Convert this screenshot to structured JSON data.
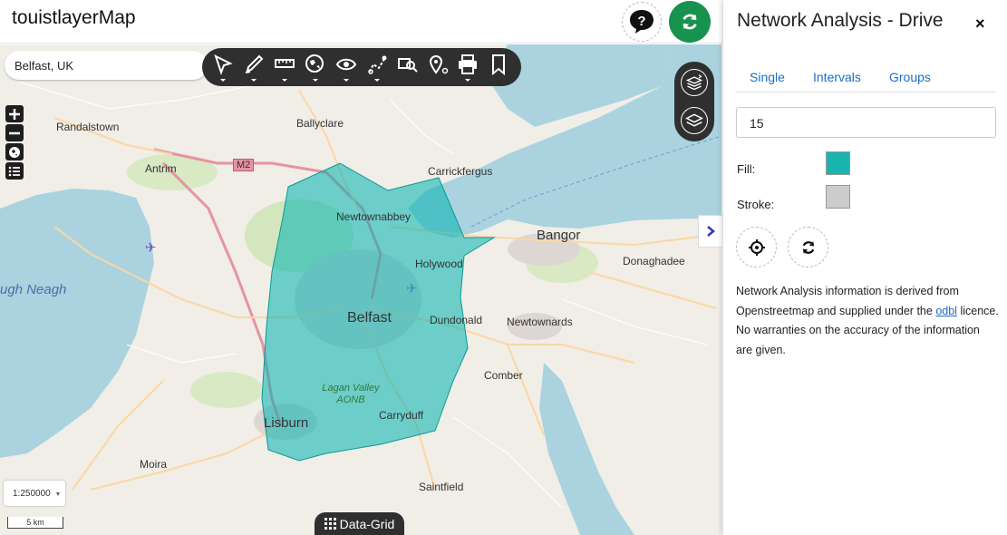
{
  "header": {
    "title": "touistlayerMap"
  },
  "search": {
    "value": "Belfast, UK"
  },
  "toolbar": {
    "tools": [
      "select-icon",
      "draw-icon",
      "measure-icon",
      "globe-search-icon",
      "eye-icon",
      "route-icon",
      "search-map-icon",
      "location-pin-icon",
      "print-icon",
      "bookmark-icon"
    ]
  },
  "map": {
    "places": {
      "randalstown": "Randalstown",
      "ballyclare": "Ballyclare",
      "antrim": "Antrim",
      "m2": "M2",
      "carrickfergus": "Carrickfergus",
      "newtownabbey": "Newtownabbey",
      "bangor": "Bangor",
      "holywood": "Holywood",
      "donaghadee": "Donaghadee",
      "lough_neagh": "ugh Neagh",
      "belfast": "Belfast",
      "dundonald": "Dundonald",
      "newtownards": "Newtownards",
      "comber": "Comber",
      "lagan": "Lagan Valley AONB",
      "carryduff": "Carryduff",
      "lisburn": "Lisburn",
      "moira": "Moira",
      "saintfield": "Saintfield"
    },
    "scale": {
      "selected": "1:250000",
      "bar_label": "5 km"
    },
    "isochrone_fill": "#00b3b0",
    "data_grid_label": "Data-Grid"
  },
  "panel": {
    "title": "Network Analysis - Drive",
    "close": "×",
    "tabs": [
      "Single",
      "Intervals",
      "Groups"
    ],
    "minutes_value": "15",
    "fill_label": "Fill:",
    "stroke_label": "Stroke:",
    "fill_color": "#1ab4ae",
    "stroke_color": "#cccccc",
    "info_text_1": "Network Analysis information is derived from Openstreetmap and supplied under the",
    "info_link": "odbl",
    "info_text_2": "licence. No warranties on the accuracy of the information are given."
  }
}
